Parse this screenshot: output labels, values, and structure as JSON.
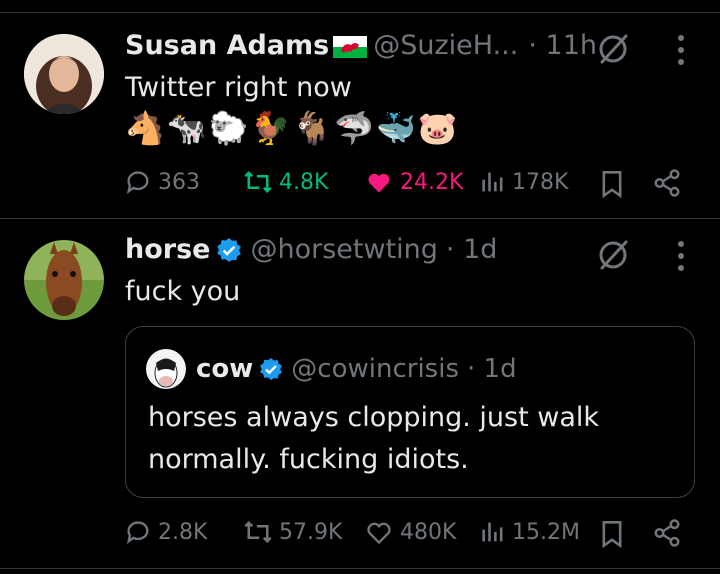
{
  "colors": {
    "accent": "#1d9bf0",
    "retweet_active": "#00ba7c",
    "like_active": "#f91880",
    "muted": "#71767b"
  },
  "tweets": [
    {
      "name": "Susan Adams",
      "handle": "@SuzieH...",
      "time": "· 11h",
      "text": "Twitter right now",
      "emojis": [
        "🐴",
        "🐄",
        "🐑",
        "🐓",
        "🐐",
        "🦈",
        "🐳",
        "🐷"
      ],
      "stats": {
        "replies": "363",
        "retweets": "4.8K",
        "likes": "24.2K",
        "views": "178K"
      },
      "retweeted": true,
      "liked": true
    },
    {
      "name": "horse",
      "handle": "@horsetwting",
      "time": "· 1d",
      "text": "fuck you",
      "quote": {
        "name": "cow",
        "handle": "@cowincrisis",
        "time": "· 1d",
        "text": "horses always clopping. just walk normally. fucking idiots."
      },
      "stats": {
        "replies": "2.8K",
        "retweets": "57.9K",
        "likes": "480K",
        "views": "15.2M"
      },
      "retweeted": false,
      "liked": false
    }
  ]
}
